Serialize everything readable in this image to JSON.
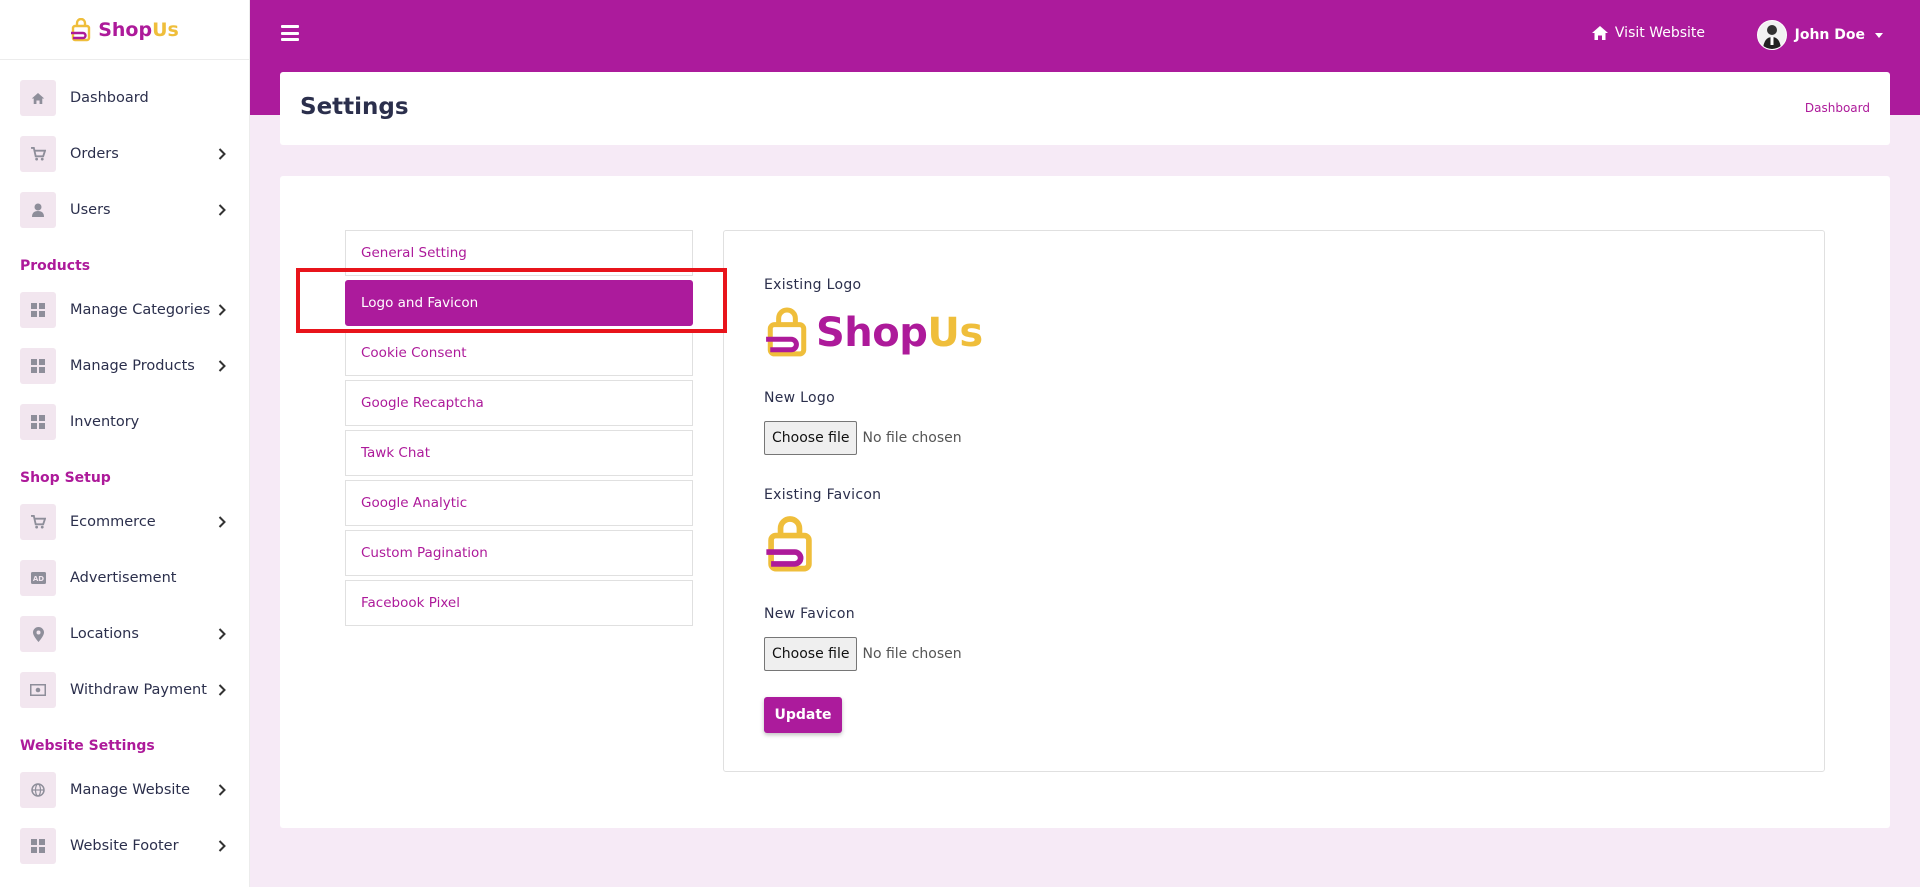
{
  "brand": {
    "name_part1": "Shop",
    "name_part2": "Us"
  },
  "colors": {
    "primary": "#ac1b9c",
    "accent": "#efbe3b",
    "highlight": "#e8141b"
  },
  "sidebar": {
    "items": [
      {
        "label": "Dashboard",
        "icon": "home-icon",
        "chevron": false
      },
      {
        "label": "Orders",
        "icon": "cart-icon",
        "chevron": true
      },
      {
        "label": "Users",
        "icon": "user-icon",
        "chevron": true
      }
    ],
    "sections": [
      {
        "title": "Products",
        "items": [
          {
            "label": "Manage Categories",
            "icon": "grid-icon",
            "chevron": true
          },
          {
            "label": "Manage Products",
            "icon": "grid-icon",
            "chevron": true
          },
          {
            "label": "Inventory",
            "icon": "grid-icon",
            "chevron": false
          }
        ]
      },
      {
        "title": "Shop Setup",
        "items": [
          {
            "label": "Ecommerce",
            "icon": "cart-icon",
            "chevron": true
          },
          {
            "label": "Advertisement",
            "icon": "ad-icon",
            "chevron": false
          },
          {
            "label": "Locations",
            "icon": "map-pin-icon",
            "chevron": true
          },
          {
            "label": "Withdraw Payment",
            "icon": "money-icon",
            "chevron": true
          }
        ]
      },
      {
        "title": "Website Settings",
        "items": [
          {
            "label": "Manage Website",
            "icon": "globe-icon",
            "chevron": true
          },
          {
            "label": "Website Footer",
            "icon": "grid-icon",
            "chevron": true
          }
        ]
      }
    ]
  },
  "topbar": {
    "visit_label": "Visit Website",
    "user_name": "John Doe"
  },
  "header": {
    "title": "Settings",
    "breadcrumb": "Dashboard"
  },
  "tabs": [
    "General Setting",
    "Logo and Favicon",
    "Cookie Consent",
    "Google Recaptcha",
    "Tawk Chat",
    "Google Analytic",
    "Custom Pagination",
    "Facebook Pixel"
  ],
  "active_tab": 1,
  "form": {
    "existing_logo_label": "Existing Logo",
    "new_logo_label": "New Logo",
    "existing_favicon_label": "Existing Favicon",
    "new_favicon_label": "New Favicon",
    "choose_file_label": "Choose file",
    "no_file_text": "No file chosen",
    "update_label": "Update"
  }
}
